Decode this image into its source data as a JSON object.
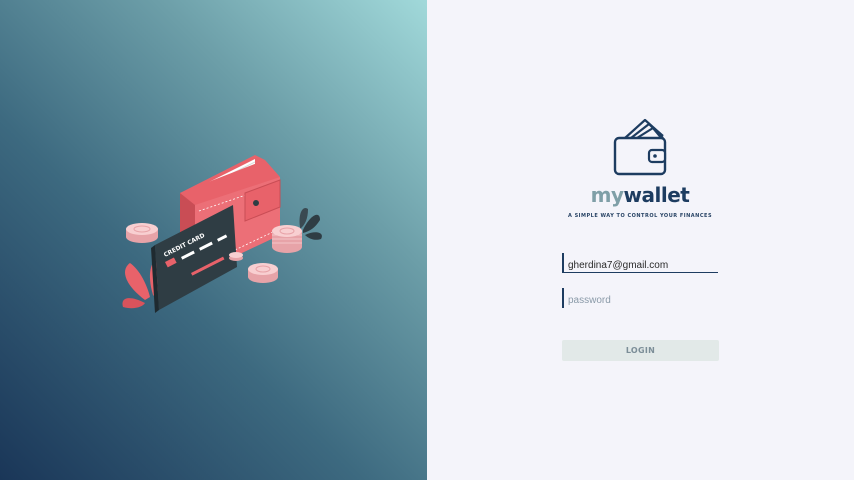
{
  "brand": {
    "name_part1": "my",
    "name_part2": "wallet",
    "tagline": "A SIMPLE WAY TO CONTROL YOUR FINANCES",
    "logo_icon": "wallet-icon"
  },
  "illustration": {
    "card_text": "CREDIT CARD",
    "icon": "wallet-and-credit-card-illustration"
  },
  "login_form": {
    "email_value": "gherdina7@gmail.com",
    "password_placeholder": "password",
    "password_value": "",
    "submit_label": "LOGIN"
  },
  "colors": {
    "primary": "#1d3c60",
    "accent": "#7f9fa7",
    "wallet_red": "#e8626a",
    "background": "#f4f4fa",
    "button_bg": "#e2e9e8"
  }
}
